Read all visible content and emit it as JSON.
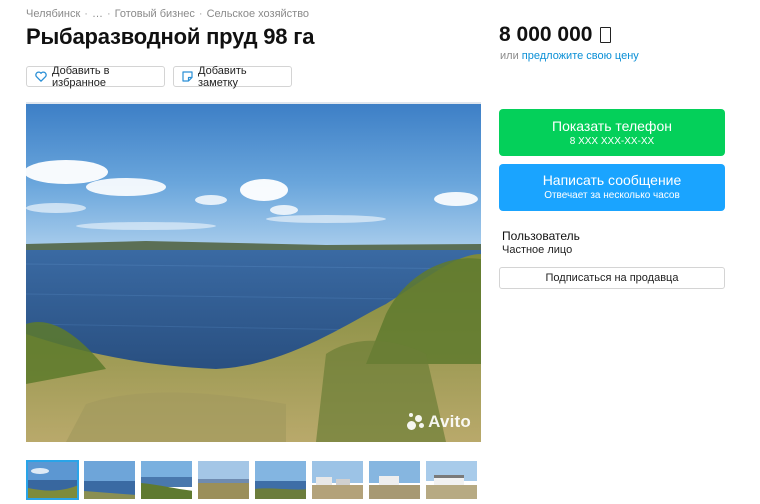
{
  "breadcrumb": {
    "items": [
      "Челябинск",
      "…",
      "Готовый бизнес",
      "Сельское хозяйство"
    ],
    "separator": "·"
  },
  "title": "Рыбаразводной пруд 98 га",
  "price": {
    "amount": "8 000 000",
    "currency_icon": "ruble-placeholder-icon",
    "offer_prefix": "или",
    "offer_link": "предложите свою цену"
  },
  "actions": {
    "favorite_label": "Добавить в избранное",
    "note_label": "Добавить заметку"
  },
  "gallery": {
    "watermark": "Avito",
    "thumbnails_count": 8,
    "active_index": 0
  },
  "contact": {
    "phone_label": "Показать телефон",
    "phone_masked": "8 XXX XXX-XX-XX",
    "message_label": "Написать сообщение",
    "message_sub": "Отвечает за несколько часов"
  },
  "seller": {
    "name": "Пользователь",
    "type": "Частное лицо",
    "subscribe_label": "Подписаться на продавца"
  },
  "colors": {
    "green": "#04d05a",
    "blue": "#1aa4ff",
    "link": "#0a8fd6",
    "thumb_active_border": "#2aa4e8"
  }
}
